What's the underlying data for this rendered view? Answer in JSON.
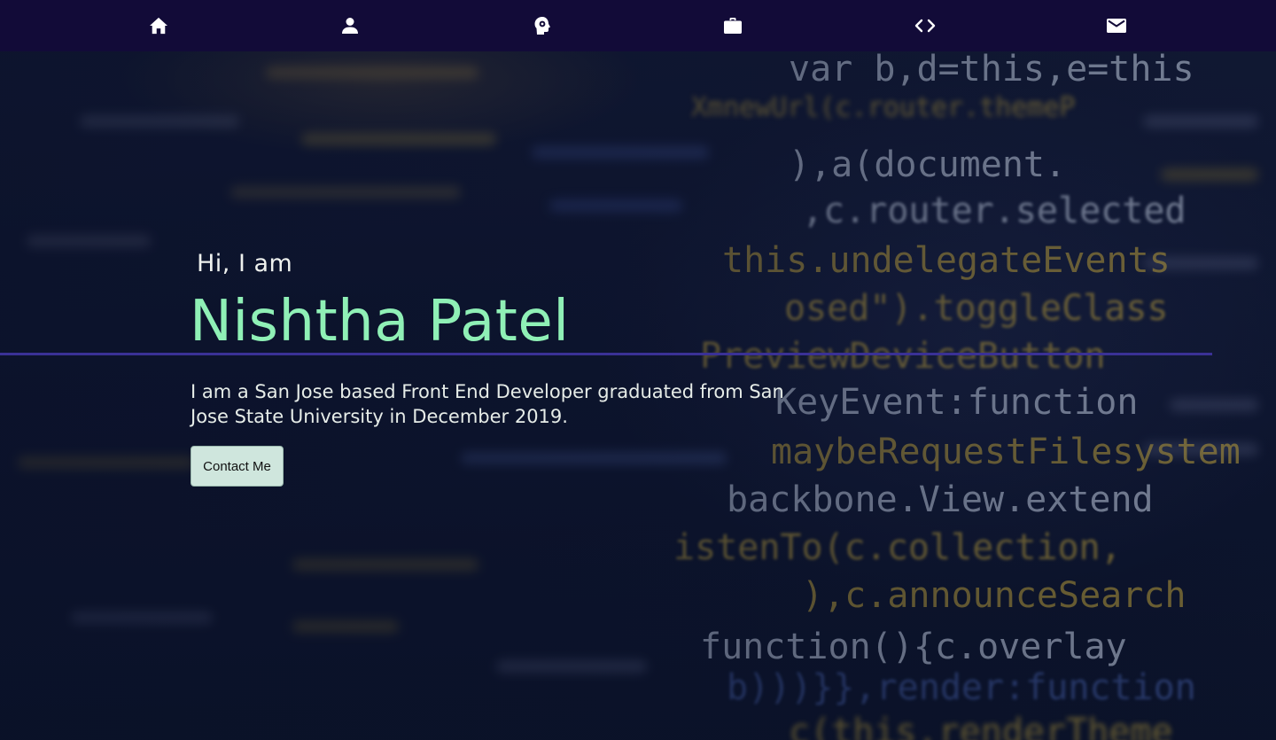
{
  "nav": {
    "items": [
      {
        "icon": "home-icon"
      },
      {
        "icon": "person-icon"
      },
      {
        "icon": "brain-gear-icon"
      },
      {
        "icon": "briefcase-icon"
      },
      {
        "icon": "code-icon"
      },
      {
        "icon": "mail-icon"
      }
    ],
    "background": "#120b38"
  },
  "hero": {
    "greeting": "Hi, I am",
    "name": "Nishtha Patel",
    "bio": "I am a San Jose based Front End Developer graduated from San Jose State University in December 2019.",
    "contact_label": "Contact Me"
  },
  "background_code": {
    "lines": [
      "var b,d=this,e=this",
      "XmnewUrl(c.router.themeP",
      "),a(document.",
      ",c.router.selected",
      "this.undelegateEvents",
      "osed\").toggleClass",
      "PreviewDeviceButton",
      "KeyEvent:function",
      "maybeRequestFilesystem",
      "backbone.View.extend",
      "istenTo(c.collection,",
      "),c.announceSearch",
      "function(){c.overlay",
      "b)))}},render:function",
      "c(this.renderTheme"
    ]
  },
  "colors": {
    "accent_name": "#8ff0b6",
    "divider": "#3a3196",
    "button_bg": "#cfe6dd",
    "text": "#e6ece8"
  }
}
